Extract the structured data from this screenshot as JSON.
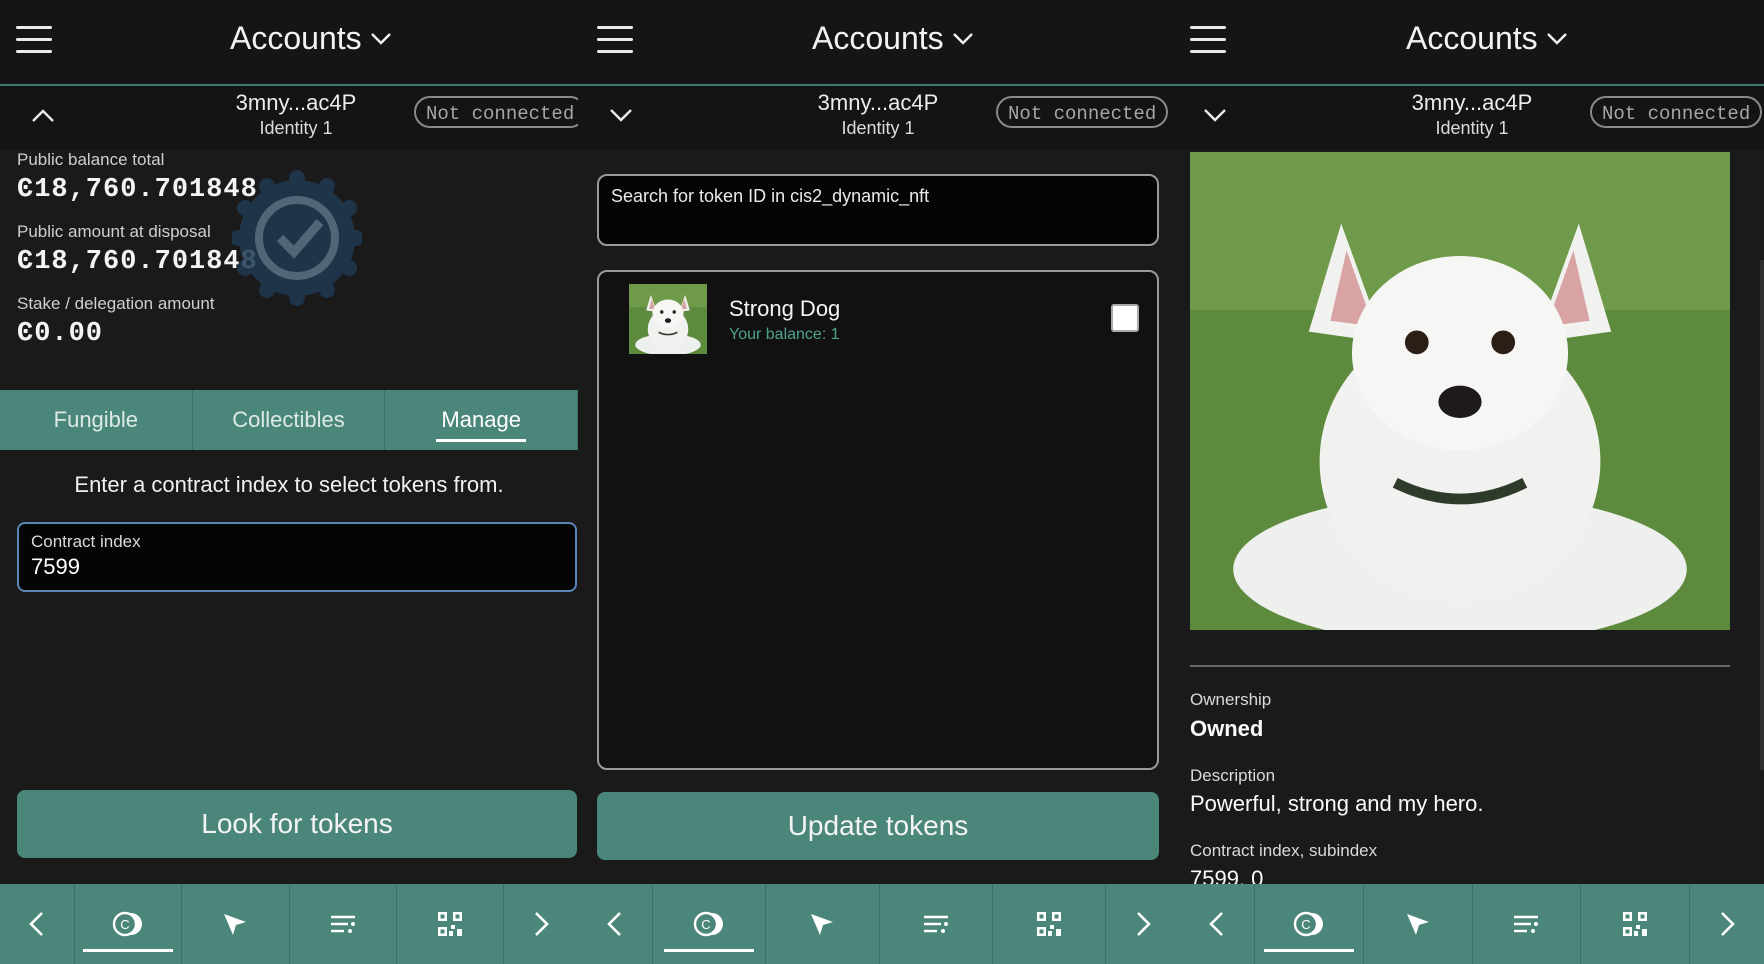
{
  "header": {
    "title": "Accounts"
  },
  "account": {
    "address": "3mny...ac4P",
    "identity": "Identity 1",
    "status": "Not connected"
  },
  "balances": {
    "public_total_label": "Public balance total",
    "public_total_value": "Ͼ18,760.701848",
    "disposal_label": "Public amount at disposal",
    "disposal_value": "Ͼ18,760.701848",
    "stake_label": "Stake / delegation amount",
    "stake_value": "Ͼ0.00"
  },
  "tabs": [
    {
      "label": "Fungible"
    },
    {
      "label": "Collectibles"
    },
    {
      "label": "Manage"
    }
  ],
  "manage": {
    "prompt": "Enter a contract index to select tokens from.",
    "contract_label": "Contract index",
    "contract_value": "7599",
    "look_button": "Look for tokens"
  },
  "tokens": {
    "search_placeholder": "Search for token ID in cis2_dynamic_nft",
    "items": [
      {
        "name": "Strong Dog",
        "balance": "Your balance: 1"
      }
    ],
    "update_button": "Update tokens"
  },
  "details": {
    "ownership_label": "Ownership",
    "ownership_value": "Owned",
    "description_label": "Description",
    "description_value": "Powerful, strong and my hero.",
    "contract_label": "Contract index, subindex",
    "contract_value": "7599, 0"
  },
  "nav": {
    "icons": [
      "back-arrow-icon",
      "tokens-icon",
      "send-icon",
      "transactions-icon",
      "qr-code-icon",
      "forward-arrow-icon"
    ]
  },
  "colors": {
    "accent": "#4b867a",
    "background": "#1a1a1a",
    "balance_green": "#4fa28f"
  }
}
